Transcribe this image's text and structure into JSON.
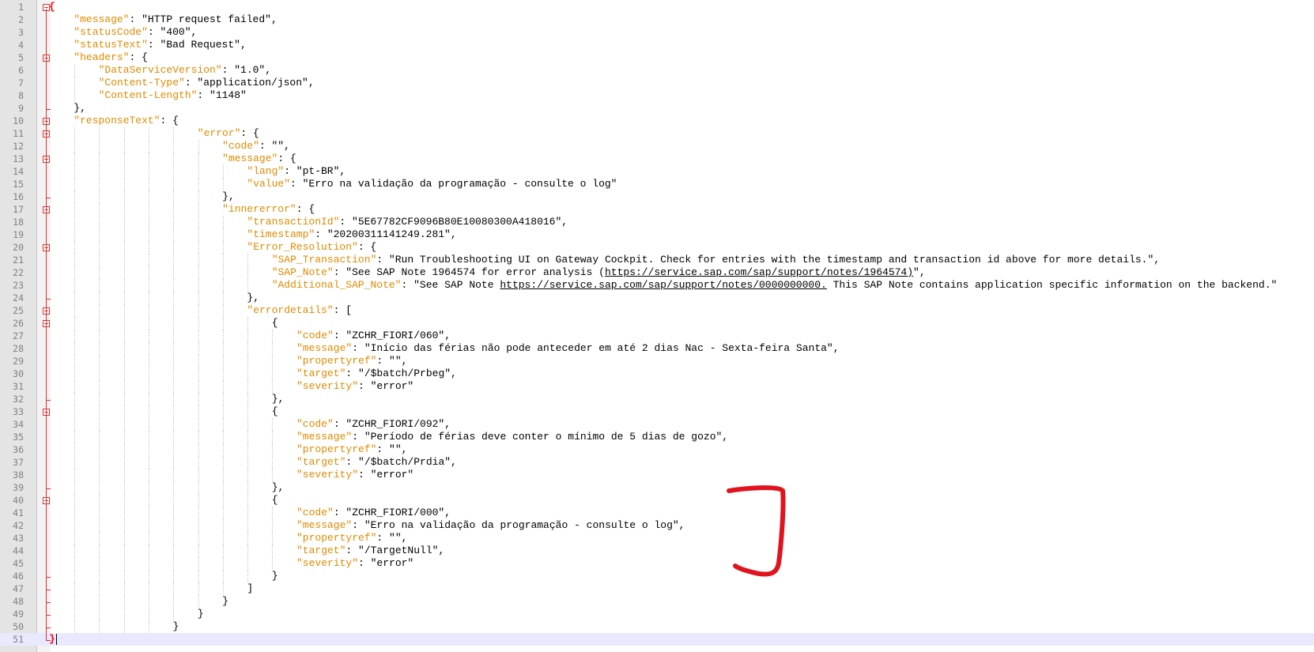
{
  "lines": [
    {
      "n": "1",
      "indent": 0,
      "fold": "open",
      "parts": [
        {
          "t": "{",
          "c": "brace-hl"
        }
      ]
    },
    {
      "n": "2",
      "indent": 1,
      "parts": [
        {
          "t": "\"message\"",
          "c": "k"
        },
        {
          "t": ": \"HTTP request failed\",",
          "c": "s"
        }
      ]
    },
    {
      "n": "3",
      "indent": 1,
      "parts": [
        {
          "t": "\"statusCode\"",
          "c": "k"
        },
        {
          "t": ": \"400\",",
          "c": "s"
        }
      ]
    },
    {
      "n": "4",
      "indent": 1,
      "parts": [
        {
          "t": "\"statusText\"",
          "c": "k"
        },
        {
          "t": ": \"Bad Request\",",
          "c": "s"
        }
      ]
    },
    {
      "n": "5",
      "indent": 1,
      "fold": "open",
      "parts": [
        {
          "t": "\"headers\"",
          "c": "k"
        },
        {
          "t": ": {",
          "c": "s"
        }
      ]
    },
    {
      "n": "6",
      "indent": 2,
      "parts": [
        {
          "t": "\"DataServiceVersion\"",
          "c": "k"
        },
        {
          "t": ": \"1.0\",",
          "c": "s"
        }
      ]
    },
    {
      "n": "7",
      "indent": 2,
      "parts": [
        {
          "t": "\"Content-Type\"",
          "c": "k"
        },
        {
          "t": ": \"application/json\",",
          "c": "s"
        }
      ]
    },
    {
      "n": "8",
      "indent": 2,
      "parts": [
        {
          "t": "\"Content-Length\"",
          "c": "k"
        },
        {
          "t": ": \"1148\"",
          "c": "s"
        }
      ]
    },
    {
      "n": "9",
      "indent": 1,
      "fold": "end",
      "parts": [
        {
          "t": "},",
          "c": "s"
        }
      ]
    },
    {
      "n": "10",
      "indent": 1,
      "fold": "open",
      "parts": [
        {
          "t": "\"responseText\"",
          "c": "k"
        },
        {
          "t": ": {",
          "c": "s"
        }
      ]
    },
    {
      "n": "11",
      "indent": 6,
      "fold": "open",
      "parts": [
        {
          "t": "\"error\"",
          "c": "k"
        },
        {
          "t": ": {",
          "c": "s"
        }
      ]
    },
    {
      "n": "12",
      "indent": 7,
      "parts": [
        {
          "t": "\"code\"",
          "c": "k"
        },
        {
          "t": ": \"\",",
          "c": "s"
        }
      ]
    },
    {
      "n": "13",
      "indent": 7,
      "fold": "open",
      "parts": [
        {
          "t": "\"message\"",
          "c": "k"
        },
        {
          "t": ": {",
          "c": "s"
        }
      ]
    },
    {
      "n": "14",
      "indent": 8,
      "parts": [
        {
          "t": "\"lang\"",
          "c": "k"
        },
        {
          "t": ": \"pt-BR\",",
          "c": "s"
        }
      ]
    },
    {
      "n": "15",
      "indent": 8,
      "parts": [
        {
          "t": "\"value\"",
          "c": "k"
        },
        {
          "t": ": \"Erro na validação da programação - consulte o log\"",
          "c": "s"
        }
      ]
    },
    {
      "n": "16",
      "indent": 7,
      "fold": "end",
      "parts": [
        {
          "t": "},",
          "c": "s"
        }
      ]
    },
    {
      "n": "17",
      "indent": 7,
      "fold": "open",
      "parts": [
        {
          "t": "\"innererror\"",
          "c": "k"
        },
        {
          "t": ": {",
          "c": "s"
        }
      ]
    },
    {
      "n": "18",
      "indent": 8,
      "parts": [
        {
          "t": "\"transactionId\"",
          "c": "k"
        },
        {
          "t": ": \"5E67782CF9096B80E10080300A418016\",",
          "c": "s"
        }
      ]
    },
    {
      "n": "19",
      "indent": 8,
      "parts": [
        {
          "t": "\"timestamp\"",
          "c": "k"
        },
        {
          "t": ": \"20200311141249.281\",",
          "c": "s"
        }
      ]
    },
    {
      "n": "20",
      "indent": 8,
      "fold": "open",
      "parts": [
        {
          "t": "\"Error_Resolution\"",
          "c": "k"
        },
        {
          "t": ": {",
          "c": "s"
        }
      ]
    },
    {
      "n": "21",
      "indent": 9,
      "parts": [
        {
          "t": "\"SAP_Transaction\"",
          "c": "k"
        },
        {
          "t": ": \"Run Troubleshooting UI on Gateway Cockpit. Check for entries with the timestamp and transaction id above for more details.\",",
          "c": "s"
        }
      ]
    },
    {
      "n": "22",
      "indent": 9,
      "parts": [
        {
          "t": "\"SAP_Note\"",
          "c": "k"
        },
        {
          "t": ": \"See SAP Note 1964574 for error analysis (",
          "c": "s"
        },
        {
          "t": "https://service.sap.com/sap/support/notes/1964574)",
          "c": "u"
        },
        {
          "t": "\",",
          "c": "s"
        }
      ]
    },
    {
      "n": "23",
      "indent": 9,
      "parts": [
        {
          "t": "\"Additional_SAP_Note\"",
          "c": "k"
        },
        {
          "t": ": \"See SAP Note ",
          "c": "s"
        },
        {
          "t": "https://service.sap.com/sap/support/notes/0000000000.",
          "c": "u"
        },
        {
          "t": " This SAP Note contains application specific information on the backend.\"",
          "c": "s"
        }
      ]
    },
    {
      "n": "24",
      "indent": 8,
      "fold": "end",
      "parts": [
        {
          "t": "},",
          "c": "s"
        }
      ]
    },
    {
      "n": "25",
      "indent": 8,
      "fold": "open",
      "parts": [
        {
          "t": "\"errordetails\"",
          "c": "k"
        },
        {
          "t": ": [",
          "c": "s"
        }
      ]
    },
    {
      "n": "26",
      "indent": 9,
      "fold": "open",
      "parts": [
        {
          "t": "{",
          "c": "s"
        }
      ]
    },
    {
      "n": "27",
      "indent": 10,
      "parts": [
        {
          "t": "\"code\"",
          "c": "k"
        },
        {
          "t": ": \"ZCHR_FIORI/060\",",
          "c": "s"
        }
      ]
    },
    {
      "n": "28",
      "indent": 10,
      "parts": [
        {
          "t": "\"message\"",
          "c": "k"
        },
        {
          "t": ": \"Início das férias não pode anteceder em até 2 dias Nac - Sexta-feira Santa\",",
          "c": "s"
        }
      ]
    },
    {
      "n": "29",
      "indent": 10,
      "parts": [
        {
          "t": "\"propertyref\"",
          "c": "k"
        },
        {
          "t": ": \"\",",
          "c": "s"
        }
      ]
    },
    {
      "n": "30",
      "indent": 10,
      "parts": [
        {
          "t": "\"target\"",
          "c": "k"
        },
        {
          "t": ": \"/$batch/Prbeg\",",
          "c": "s"
        }
      ]
    },
    {
      "n": "31",
      "indent": 10,
      "parts": [
        {
          "t": "\"severity\"",
          "c": "k"
        },
        {
          "t": ": \"error\"",
          "c": "s"
        }
      ]
    },
    {
      "n": "32",
      "indent": 9,
      "fold": "end",
      "parts": [
        {
          "t": "},",
          "c": "s"
        }
      ]
    },
    {
      "n": "33",
      "indent": 9,
      "fold": "open",
      "parts": [
        {
          "t": "{",
          "c": "s"
        }
      ]
    },
    {
      "n": "34",
      "indent": 10,
      "parts": [
        {
          "t": "\"code\"",
          "c": "k"
        },
        {
          "t": ": \"ZCHR_FIORI/092\",",
          "c": "s"
        }
      ]
    },
    {
      "n": "35",
      "indent": 10,
      "parts": [
        {
          "t": "\"message\"",
          "c": "k"
        },
        {
          "t": ": \"Período de férias deve conter o mínimo de 5 dias de gozo\",",
          "c": "s"
        }
      ]
    },
    {
      "n": "36",
      "indent": 10,
      "parts": [
        {
          "t": "\"propertyref\"",
          "c": "k"
        },
        {
          "t": ": \"\",",
          "c": "s"
        }
      ]
    },
    {
      "n": "37",
      "indent": 10,
      "parts": [
        {
          "t": "\"target\"",
          "c": "k"
        },
        {
          "t": ": \"/$batch/Prdia\",",
          "c": "s"
        }
      ]
    },
    {
      "n": "38",
      "indent": 10,
      "parts": [
        {
          "t": "\"severity\"",
          "c": "k"
        },
        {
          "t": ": \"error\"",
          "c": "s"
        }
      ]
    },
    {
      "n": "39",
      "indent": 9,
      "fold": "end",
      "parts": [
        {
          "t": "},",
          "c": "s"
        }
      ]
    },
    {
      "n": "40",
      "indent": 9,
      "fold": "open",
      "parts": [
        {
          "t": "{",
          "c": "s"
        }
      ]
    },
    {
      "n": "41",
      "indent": 10,
      "parts": [
        {
          "t": "\"code\"",
          "c": "k"
        },
        {
          "t": ": \"ZCHR_FIORI/000\",",
          "c": "s"
        }
      ]
    },
    {
      "n": "42",
      "indent": 10,
      "parts": [
        {
          "t": "\"message\"",
          "c": "k"
        },
        {
          "t": ": \"Erro na validação da programação - consulte o log\",",
          "c": "s"
        }
      ]
    },
    {
      "n": "43",
      "indent": 10,
      "parts": [
        {
          "t": "\"propertyref\"",
          "c": "k"
        },
        {
          "t": ": \"\",",
          "c": "s"
        }
      ]
    },
    {
      "n": "44",
      "indent": 10,
      "parts": [
        {
          "t": "\"target\"",
          "c": "k"
        },
        {
          "t": ": \"/TargetNull\",",
          "c": "s"
        }
      ]
    },
    {
      "n": "45",
      "indent": 10,
      "parts": [
        {
          "t": "\"severity\"",
          "c": "k"
        },
        {
          "t": ": \"error\"",
          "c": "s"
        }
      ]
    },
    {
      "n": "46",
      "indent": 9,
      "fold": "end",
      "parts": [
        {
          "t": "}",
          "c": "s"
        }
      ]
    },
    {
      "n": "47",
      "indent": 8,
      "fold": "end",
      "parts": [
        {
          "t": "]",
          "c": "s"
        }
      ]
    },
    {
      "n": "48",
      "indent": 7,
      "fold": "end",
      "parts": [
        {
          "t": "}",
          "c": "s"
        }
      ]
    },
    {
      "n": "49",
      "indent": 6,
      "fold": "end",
      "parts": [
        {
          "t": "}",
          "c": "s"
        }
      ]
    },
    {
      "n": "50",
      "indent": 5,
      "fold": "end",
      "parts": [
        {
          "t": "}",
          "c": "s"
        }
      ]
    },
    {
      "n": "51",
      "indent": 0,
      "fold": "end",
      "current": true,
      "parts": [
        {
          "t": "}",
          "c": "brace-hl"
        }
      ]
    }
  ],
  "colors": {
    "key": "#e08a00",
    "text": "#000000",
    "fold_marker": "#dd3333",
    "annotation": "#e0141e",
    "current_line": "#e8e8ff"
  }
}
